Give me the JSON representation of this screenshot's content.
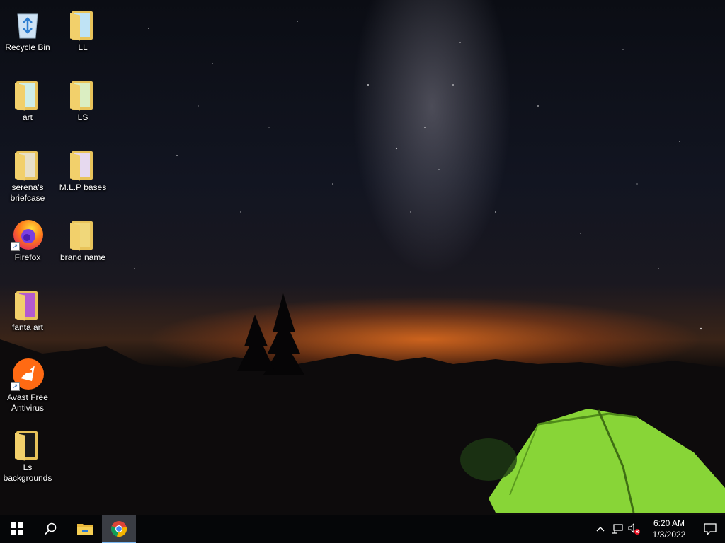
{
  "desktop": {
    "icons": [
      {
        "label": "Recycle Bin",
        "icon": "recycle-bin-icon"
      },
      {
        "label": "LL",
        "icon": "folder-icon"
      },
      {
        "label": "art",
        "icon": "folder-icon"
      },
      {
        "label": "LS",
        "icon": "folder-icon"
      },
      {
        "label": "serena's briefcase",
        "icon": "folder-icon"
      },
      {
        "label": "M.L.P bases",
        "icon": "folder-icon"
      },
      {
        "label": "Firefox",
        "icon": "firefox-icon"
      },
      {
        "label": "brand name",
        "icon": "folder-icon"
      },
      {
        "label": "fanta art",
        "icon": "folder-icon"
      },
      {
        "label": "Avast Free Antivirus",
        "icon": "avast-icon"
      },
      {
        "label": "Ls backgrounds",
        "icon": "folder-icon"
      }
    ]
  },
  "taskbar": {
    "start": "windows-logo-icon",
    "search": "search-icon",
    "pinned": [
      "file-explorer-icon",
      "chrome-icon"
    ],
    "tray": {
      "chevron": "chevron-up-icon",
      "network": "network-icon",
      "volume": "volume-muted-icon",
      "time": "6:20 AM",
      "date": "1/3/2022",
      "notifications": "notification-icon"
    }
  },
  "colors": {
    "taskbar": "#050608",
    "active_indicator": "#7ab6f0",
    "tent": "#8fe03a",
    "horizon_glow": "#e06a1e"
  }
}
